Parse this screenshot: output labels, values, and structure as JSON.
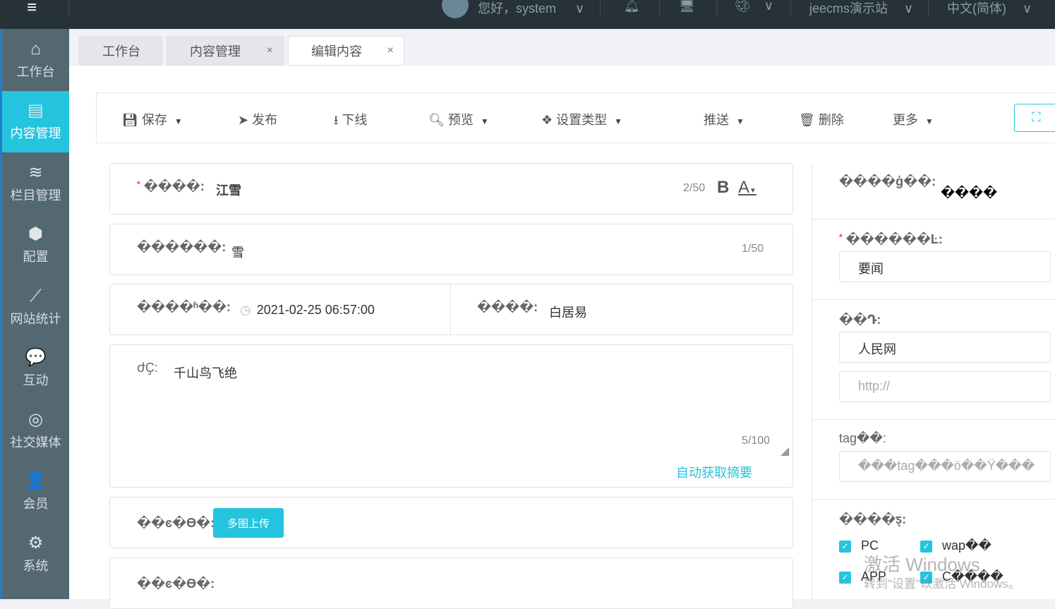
{
  "topbar": {
    "menu_icon": "hamburger-icon",
    "greeting": "您好，system",
    "site": "jeecms演示站",
    "language": "中文(简体)"
  },
  "sidebar": {
    "items": [
      {
        "label": "工作台",
        "icon": "⌂"
      },
      {
        "label": "内容管理",
        "icon": "▤"
      },
      {
        "label": "栏目管理",
        "icon": "≋"
      },
      {
        "label": "配置",
        "icon": "⬢"
      },
      {
        "label": "网站统计",
        "icon": "⟋"
      },
      {
        "label": "互动",
        "icon": "💬"
      },
      {
        "label": "社交媒体",
        "icon": "◎"
      },
      {
        "label": "会员",
        "icon": "👤"
      },
      {
        "label": "系统",
        "icon": "⚙"
      }
    ]
  },
  "tabs": [
    {
      "label": "工作台"
    },
    {
      "label": "内容管理",
      "close": "×"
    },
    {
      "label": "编辑内容",
      "close": "×"
    }
  ],
  "toolbar": {
    "save": "保存",
    "publish": "发布",
    "offline": "下线",
    "preview": "预览",
    "set_type": "设置类型",
    "push": "推送",
    "delete": "删除",
    "more": "更多",
    "fullscreen": "⛶"
  },
  "form": {
    "title_label": "����:",
    "title_value": "江雪",
    "title_count": "2/50",
    "bold": "B",
    "font_color": "A",
    "short_title_label": "������:",
    "short_title_value": "雪",
    "short_title_count": "1/50",
    "time_label": "����ʱ��:",
    "time_value": "2021-02-25 06:57:00",
    "author_label": "����:",
    "author_value": "白居易",
    "summary_label": "ժҪ:",
    "summary_value": "千山鸟飞绝",
    "summary_count": "5/100",
    "auto_summary": "自动获取摘要",
    "multi_upload_label": "��ͼ�ϴ�:",
    "multi_upload_button": "多图上传",
    "other_label": "��ͼ�ϴ�:"
  },
  "right": {
    "model_label": "����ģ��:",
    "model_value": "����",
    "channel_label": "������Ŀ:",
    "channel_value": "要闻",
    "source_label": "��Դ:",
    "source_value": "人民网",
    "source_url_placeholder": "http://",
    "tag_label": "tag��:",
    "tag_placeholder": "���tag���ö��Ÿ���",
    "publish_label": "����ƽ̨:",
    "platforms": [
      {
        "label": "PC"
      },
      {
        "label": "wap��"
      },
      {
        "label": "APP"
      },
      {
        "label": "C����"
      }
    ]
  },
  "watermark": {
    "line1": "激活 Windows",
    "line2": "转到\"设置\"以激活 Windows。"
  },
  "colors": {
    "accent": "#25c4de",
    "topbar": "#263238",
    "sidebar": "#546872"
  }
}
